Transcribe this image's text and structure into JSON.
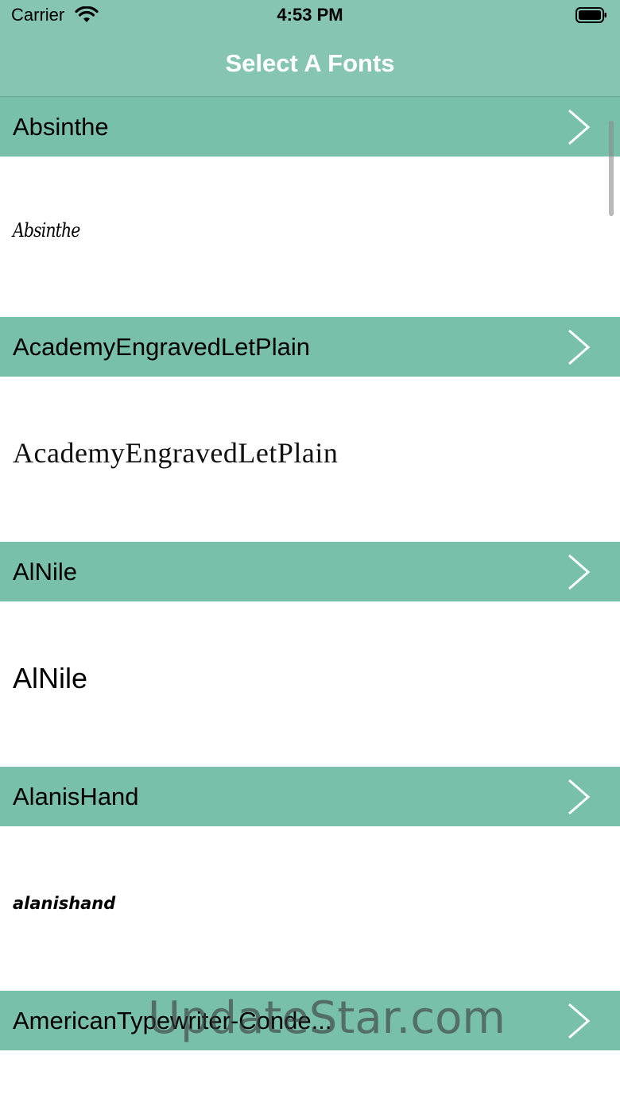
{
  "status_bar": {
    "carrier": "Carrier",
    "time": "4:53 PM"
  },
  "nav": {
    "title": "Select A Fonts"
  },
  "fonts": [
    {
      "header": "Absinthe",
      "preview": "Absinthe"
    },
    {
      "header": "AcademyEngravedLetPlain",
      "preview": "AcademyEngravedLetPlain"
    },
    {
      "header": "AlNile",
      "preview": "AlNile"
    },
    {
      "header": "AlanisHand",
      "preview": "alanishand"
    },
    {
      "header": "AmericanTypewriter-Conde..."
    }
  ],
  "watermark": "UpdateStar.com",
  "colors": {
    "bar": "#86c5b2",
    "header": "#78c0aa",
    "title": "#ffffff"
  }
}
